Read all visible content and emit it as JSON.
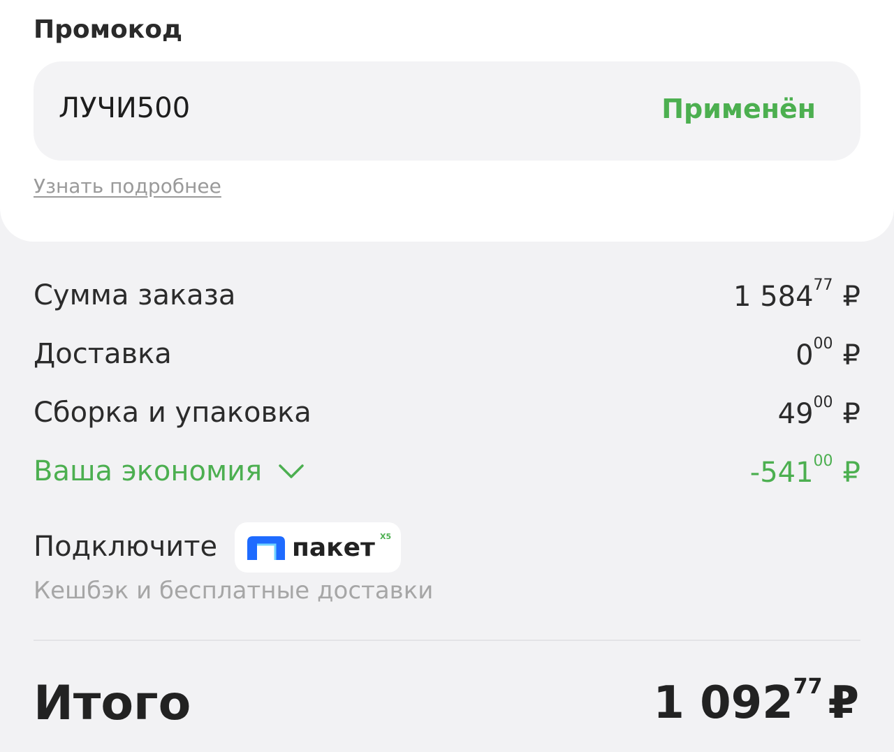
{
  "promo": {
    "title": "Промокод",
    "code": "ЛУЧИ500",
    "status": "Применён",
    "more_link": "Узнать подробнее"
  },
  "summary": {
    "order_sum": {
      "label": "Сумма заказа",
      "int": "1 584",
      "frac": "77",
      "currency": "₽"
    },
    "delivery": {
      "label": "Доставка",
      "int": "0",
      "frac": "00",
      "currency": "₽"
    },
    "packing": {
      "label": "Сборка и упаковка",
      "int": "49",
      "frac": "00",
      "currency": "₽"
    },
    "savings": {
      "label": "Ваша экономия",
      "int": "-541",
      "frac": "00",
      "currency": "₽"
    }
  },
  "paket": {
    "connect_label": "Подключите",
    "brand": "пакет",
    "brand_mark": "X5",
    "subtitle": "Кешбэк и бесплатные доставки"
  },
  "total": {
    "label": "Итого",
    "int": "1 092",
    "frac": "77",
    "currency": "₽"
  },
  "colors": {
    "accent_green": "#4caf50",
    "paket_blue": "#1e6bff",
    "background": "#f2f2f4"
  },
  "icons": {
    "savings_toggle": "chevron-down-icon",
    "paket_logo": "paket-arch-icon"
  }
}
